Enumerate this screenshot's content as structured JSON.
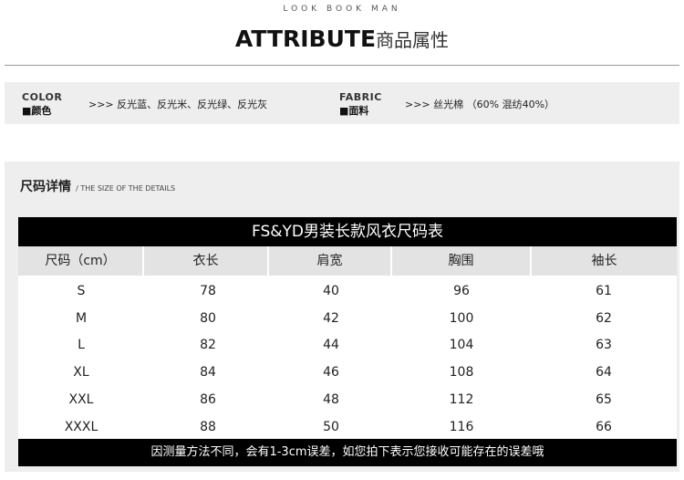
{
  "header": {
    "tagline": "LOOK BOOK MAN",
    "title_en": "ATTRIBUTE",
    "title_cn": "商品属性"
  },
  "attributes": {
    "color": {
      "label_en": "COLOR",
      "label_cn": "■颜色",
      "value": ">>> 反光蓝、反光米、反光绿、反光灰"
    },
    "fabric": {
      "label_en": "FABRIC",
      "label_cn": "■面料",
      "value": ">>> 丝光棉  （60% 混纺40%）"
    }
  },
  "size_section": {
    "heading_cn": "尺码详情",
    "heading_en": "/ THE SIZE OF THE DETAILS",
    "table_title": "FS&YD男装长款风衣尺码表",
    "columns": [
      "尺码（cm）",
      "衣长",
      "肩宽",
      "胸围",
      "袖长"
    ],
    "rows": [
      [
        "S",
        "78",
        "40",
        "96",
        "61"
      ],
      [
        "M",
        "80",
        "42",
        "100",
        "62"
      ],
      [
        "L",
        "82",
        "44",
        "104",
        "63"
      ],
      [
        "XL",
        "84",
        "46",
        "108",
        "64"
      ],
      [
        "XXL",
        "86",
        "48",
        "112",
        "65"
      ],
      [
        "XXXL",
        "88",
        "50",
        "116",
        "66"
      ]
    ],
    "footnote": "因测量方法不同，会有1-3cm误差，如您拍下表示您接收可能存在的误差哦"
  }
}
